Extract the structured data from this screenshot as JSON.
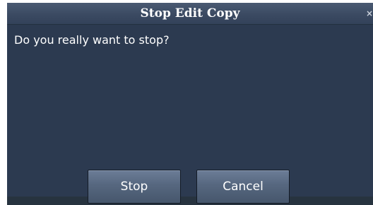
{
  "dialog": {
    "title": "Stop Edit Copy",
    "close_symbol": "×",
    "message": "Do you really want to stop?",
    "buttons": {
      "stop_label": "Stop",
      "cancel_label": "Cancel"
    }
  },
  "colors": {
    "background": "#2c3a50",
    "titlebar": "#3b4a62",
    "button": "#56677f",
    "text": "#ffffff"
  },
  "icons": {
    "close": "close-icon"
  }
}
